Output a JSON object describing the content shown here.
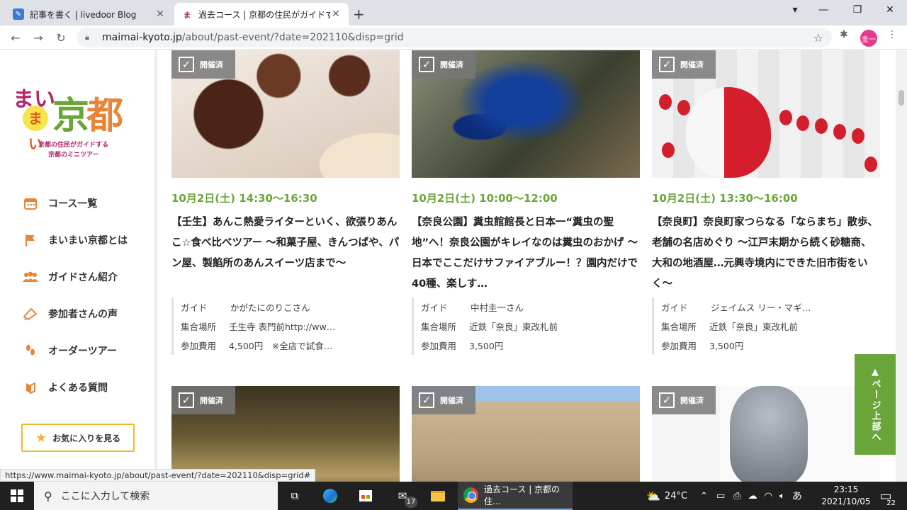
{
  "browser": {
    "tabs": [
      {
        "title": "記事を書く | livedoor Blog",
        "close": "✕"
      },
      {
        "title": "過去コース | 京都の住民がガイドする",
        "close": "✕"
      }
    ],
    "new_tab": "+",
    "url_host": "maimai-kyoto.jp",
    "url_path": "/about/past-event/?date=202110&disp=grid",
    "avatar_label": "圭一",
    "status_url": "https://www.maimai-kyoto.jp/about/past-event/?date=202110&disp=grid#"
  },
  "site": {
    "logo": {
      "mai1": "まい",
      "mai2": "まい",
      "kyo": "京",
      "to": "都",
      "tagline1": "京都の住民がガイドする",
      "tagline2": "京都のミニツアー"
    },
    "nav": [
      {
        "label": "コース一覧",
        "icon": "calendar-icon"
      },
      {
        "label": "まいまい京都とは",
        "icon": "flag-icon"
      },
      {
        "label": "ガイドさん紹介",
        "icon": "people-icon"
      },
      {
        "label": "参加者さんの声",
        "icon": "megaphone-icon"
      },
      {
        "label": "オーダーツアー",
        "icon": "footprints-icon"
      },
      {
        "label": "よくある質問",
        "icon": "book-icon"
      }
    ],
    "fav_button": "お気に入りを見る",
    "page_top": "ページ上部へ",
    "meta_labels": {
      "guide": "ガイド",
      "place": "集合場所",
      "fee": "参加費用"
    },
    "badge": "開催済"
  },
  "events": [
    {
      "date": "10月2日(土) 14:30〜16:30",
      "title": "【壬生】あんこ熱愛ライターといく、欲張りあんこ☆食べ比べツアー 〜和菓子屋、きんつばや、パン屋、製餡所のあんスイーツ店まで〜",
      "guide": "かがたにのりこさん",
      "place": "壬生寺 表門前http://ww…",
      "fee": "4,500円　※全店で試食…"
    },
    {
      "date": "10月2日(土) 10:00〜12:00",
      "title": "【奈良公園】糞虫館館長と日本一“糞虫の聖地”へ！奈良公園がキレイなのは糞虫のおかげ 〜日本でここだけサファイアブルー！？園内だけで40種、楽しす…",
      "guide": "中村圭一さん",
      "place": "近鉄「奈良」東改札前",
      "fee": "3,500円"
    },
    {
      "date": "10月2日(土) 13:30〜16:00",
      "title": "【奈良町】奈良町家つらなる「ならまち」散歩、老舗の名店めぐり 〜江戸末期から続く砂糖商、大和の地酒屋…元興寺境内にできた旧市街をいく〜",
      "guide": "ジェイムス リー・マギ…",
      "place": "近鉄「奈良」東改札前",
      "fee": "3,500円"
    }
  ],
  "taskbar": {
    "search_placeholder": "ここに入力して検索",
    "mail_badge": "17",
    "chrome_title": "過去コース | 京都の住…",
    "temperature": "24°C",
    "ime": "あ",
    "time": "23:15",
    "date": "2021/10/05",
    "notifications": "22"
  }
}
